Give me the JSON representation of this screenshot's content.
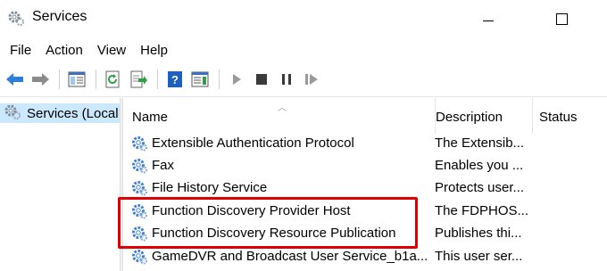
{
  "window": {
    "title": "Services",
    "icon": "services-gear-icon"
  },
  "menu": [
    {
      "label": "File"
    },
    {
      "label": "Action"
    },
    {
      "label": "View"
    },
    {
      "label": "Help"
    }
  ],
  "toolbar": {
    "buttons": [
      "back-arrow-icon",
      "forward-arrow-icon",
      "show-hide-console-tree-icon",
      "refresh-icon",
      "export-list-icon",
      "help-icon",
      "properties-pane-icon",
      "start-service-icon",
      "stop-service-icon",
      "pause-service-icon",
      "restart-service-icon"
    ]
  },
  "tree": {
    "selected_label": "Services (Local"
  },
  "list": {
    "columns": {
      "name": "Name",
      "description": "Description",
      "status": "Status"
    },
    "rows": [
      {
        "name": "Extensible Authentication Protocol",
        "description": "The Extensib...",
        "status": ""
      },
      {
        "name": "Fax",
        "description": "Enables you ...",
        "status": ""
      },
      {
        "name": "File History Service",
        "description": "Protects user...",
        "status": ""
      },
      {
        "name": "Function Discovery Provider Host",
        "description": "The FDPHOS...",
        "status": ""
      },
      {
        "name": "Function Discovery Resource Publication",
        "description": "Publishes thi...",
        "status": ""
      },
      {
        "name": "GameDVR and Broadcast User Service_b1a...",
        "description": "This user ser...",
        "status": ""
      }
    ]
  },
  "colors": {
    "selection": "#cce8ff",
    "highlight_border": "#e10000",
    "gear_blue": "#3a7bd5"
  }
}
